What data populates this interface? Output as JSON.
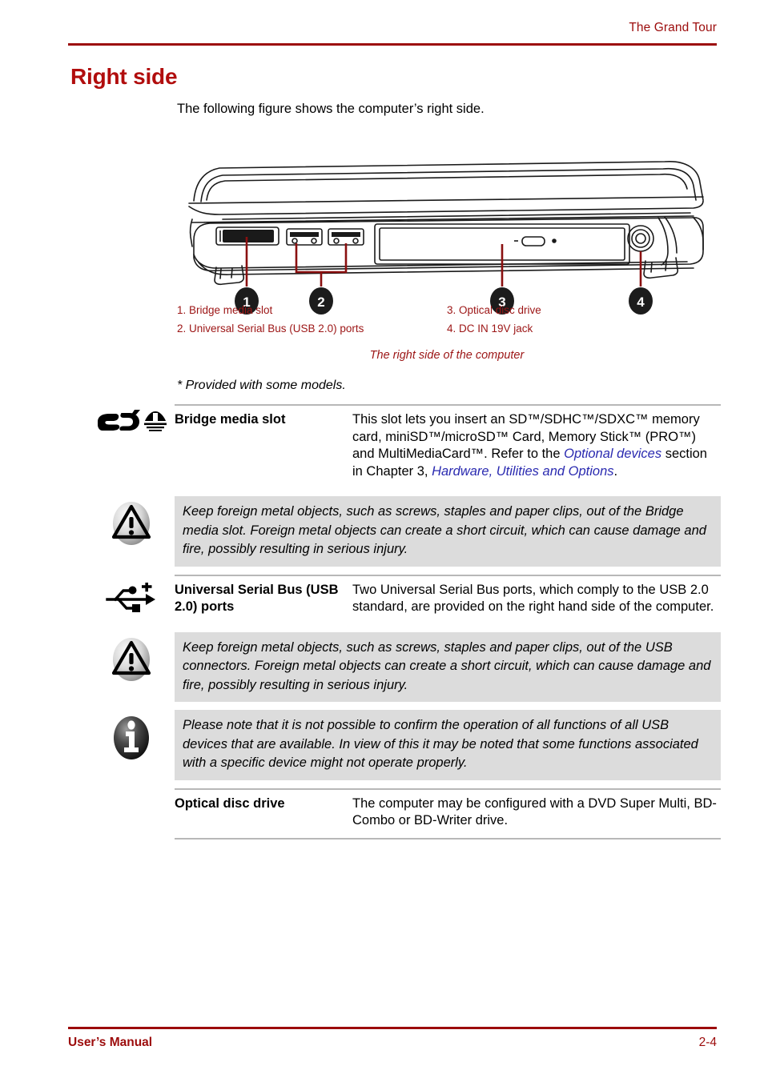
{
  "header": {
    "title": "The Grand Tour",
    "rule_color": "#9c0c0c"
  },
  "section": {
    "title": "Right side",
    "intro": "The following figure shows the computer’s right side."
  },
  "figure": {
    "callout_markers": [
      "1",
      "2",
      "3",
      "4"
    ],
    "legend": [
      {
        "left": "1. Bridge media slot",
        "right": "3. Optical disc drive"
      },
      {
        "left": "2. Universal Serial Bus (USB 2.0) ports",
        "right": "4. DC IN 19V jack"
      }
    ],
    "caption": "The right side of the computer",
    "caption_color": "#9c1515"
  },
  "provided_note": "* Provided with some models.",
  "definitions": [
    {
      "icon": "sd-card-icon",
      "icon2": "bridge-media-icon",
      "term": "Bridge media slot",
      "desc_plain_1": "This slot lets you insert an SD™/SDHC™/SDXC™ memory card, miniSD™/microSD™ Card, Memory Stick™ (PRO™) and MultiMediaCard™. Refer to the ",
      "desc_link_1": "Optional devices",
      "desc_plain_2": " section in Chapter 3, ",
      "desc_link_2": "Hardware, Utilities and Options",
      "desc_plain_3": "."
    },
    {
      "icon": "usb-icon",
      "term": "Universal Serial Bus (USB 2.0) ports",
      "desc": "Two Universal Serial Bus ports, which comply to the USB 2.0 standard, are provided on the right hand side of the computer."
    },
    {
      "icon": "optical-disc-icon",
      "term": "Optical disc drive",
      "desc": "The computer may be configured with a DVD Super Multi, BD-Combo or BD-Writer drive."
    }
  ],
  "callouts": [
    {
      "icon": "warning-triangle-icon",
      "text": "Keep foreign metal objects, such as screws, staples and paper clips, out of the Bridge media slot. Foreign metal objects can create a short circuit, which can cause damage and fire, possibly resulting in serious injury."
    },
    {
      "icon": "warning-triangle-icon",
      "text": "Keep foreign metal objects, such as screws, staples and paper clips, out of the USB connectors. Foreign metal objects can create a short circuit, which can cause damage and fire, possibly resulting in serious injury."
    },
    {
      "icon": "info-circle-icon",
      "text": "Please note that it is not possible to confirm the operation of all functions of all USB devices that are available. In view of this it may be noted that some functions associated with a specific device might not operate properly."
    }
  ],
  "footer": {
    "left": "User’s Manual",
    "right": "2-4"
  }
}
